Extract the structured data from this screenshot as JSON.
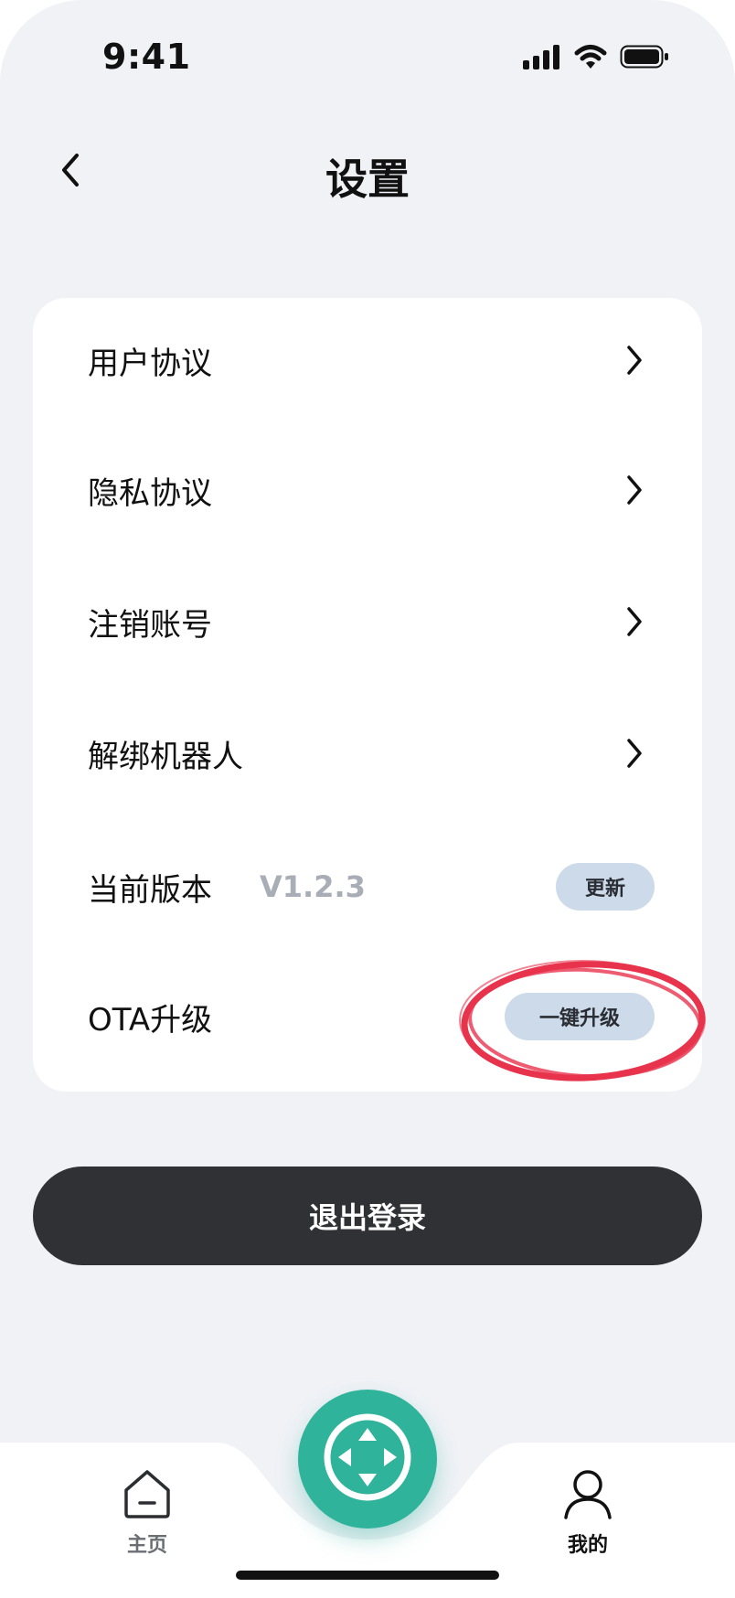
{
  "status_bar": {
    "time": "9:41"
  },
  "header": {
    "title": "设置",
    "back_icon": "chevron-left-icon"
  },
  "settings": {
    "items": [
      {
        "label": "用户协议"
      },
      {
        "label": "隐私协议"
      },
      {
        "label": "注销账号"
      },
      {
        "label": "解绑机器人"
      }
    ],
    "version": {
      "label": "当前版本",
      "value": "V1.2.3",
      "button_label": "更新"
    },
    "ota": {
      "label": "OTA升级",
      "button_label": "一键升级",
      "highlight_color": "#e8334c"
    }
  },
  "logout": {
    "label": "退出登录"
  },
  "tab_bar": {
    "home_label": "主页",
    "mine_label": "我的",
    "center_icon": "direction-pad-icon",
    "center_color": "#2fb39a"
  }
}
